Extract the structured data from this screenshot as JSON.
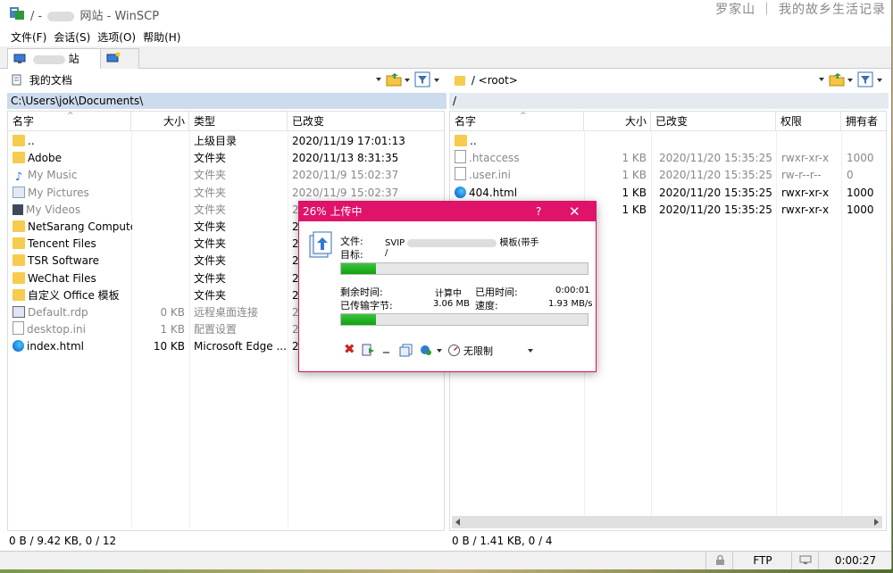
{
  "window": {
    "title_prefix": "/ -",
    "title_mid": "网站 - WinSCP",
    "watermark": "罗家山 ｜ 我的故乡生活记录"
  },
  "menu": [
    "文件(F)",
    "会话(S)",
    "选项(O)",
    "帮助(H)"
  ],
  "tabs": {
    "site_label": "站"
  },
  "left": {
    "path_dropdown": "我的文档",
    "path": "C:\\Users\\jok\\Documents\\",
    "columns": [
      "名字",
      "大小",
      "类型",
      "已改变"
    ],
    "rows": [
      {
        "name": "..",
        "size": "",
        "type": "上级目录",
        "date": "2020/11/19  17:01:13",
        "icon": "up-folder",
        "dim": false
      },
      {
        "name": "Adobe",
        "size": "",
        "type": "文件夹",
        "date": "2020/11/13  8:31:35",
        "icon": "folder",
        "dim": false
      },
      {
        "name": "My Music",
        "size": "",
        "type": "文件夹",
        "date": "2020/11/9  15:02:37",
        "icon": "music",
        "dim": true
      },
      {
        "name": "My Pictures",
        "size": "",
        "type": "文件夹",
        "date": "2020/11/9  15:02:37",
        "icon": "pictures",
        "dim": true
      },
      {
        "name": "My Videos",
        "size": "",
        "type": "文件夹",
        "date": "2",
        "icon": "videos",
        "dim": true
      },
      {
        "name": "NetSarang Computer",
        "size": "",
        "type": "文件夹",
        "date": "2",
        "icon": "folder",
        "dim": false
      },
      {
        "name": "Tencent Files",
        "size": "",
        "type": "文件夹",
        "date": "2",
        "icon": "folder",
        "dim": false
      },
      {
        "name": "TSR Software",
        "size": "",
        "type": "文件夹",
        "date": "2",
        "icon": "folder",
        "dim": false
      },
      {
        "name": "WeChat Files",
        "size": "",
        "type": "文件夹",
        "date": "2",
        "icon": "folder",
        "dim": false
      },
      {
        "name": "自定义 Office 模板",
        "size": "",
        "type": "文件夹",
        "date": "2",
        "icon": "folder",
        "dim": false
      },
      {
        "name": "Default.rdp",
        "size": "0 KB",
        "type": "远程桌面连接",
        "date": "2",
        "icon": "rdp",
        "dim": true
      },
      {
        "name": "desktop.ini",
        "size": "1 KB",
        "type": "配置设置",
        "date": "2",
        "icon": "doc",
        "dim": true
      },
      {
        "name": "index.html",
        "size": "10 KB",
        "type": "Microsoft Edge ...",
        "date": "2",
        "icon": "edge",
        "dim": false
      }
    ],
    "status": "0 B / 9.42 KB,  0 / 12"
  },
  "right": {
    "path_dropdown": "/ <root>",
    "path": "/",
    "columns": [
      "名字",
      "大小",
      "已改变",
      "权限",
      "拥有者"
    ],
    "rows": [
      {
        "name": "..",
        "size": "",
        "date": "",
        "perm": "",
        "owner": "",
        "icon": "up-folder",
        "dim": false
      },
      {
        "name": ".htaccess",
        "size": "1 KB",
        "date": "2020/11/20 15:35:25",
        "perm": "rwxr-xr-x",
        "owner": "1000",
        "icon": "doc",
        "dim": true
      },
      {
        "name": ".user.ini",
        "size": "1 KB",
        "date": "2020/11/20 15:35:25",
        "perm": "rw-r--r--",
        "owner": "0",
        "icon": "doc",
        "dim": true
      },
      {
        "name": "404.html",
        "size": "1 KB",
        "date": "2020/11/20 15:35:25",
        "perm": "rwxr-xr-x",
        "owner": "1000",
        "icon": "edge",
        "dim": false
      },
      {
        "name": "",
        "size": "1 KB",
        "date": "2020/11/20 15:35:25",
        "perm": "rwxr-xr-x",
        "owner": "1000",
        "icon": "",
        "dim": false
      }
    ],
    "status": "0 B / 1.41 KB,  0 / 4"
  },
  "bottom": {
    "protocol": "FTP",
    "elapsed": "0:00:27"
  },
  "dialog": {
    "title": "26% 上传中",
    "help": "?",
    "close": "✕",
    "file_label": "文件:",
    "file_value": "SVIP",
    "file_value_tail": "模板(带手",
    "target_label": "目标:",
    "target_value": "/",
    "file_progress": 0.14,
    "remaining_label": "剩余时间:",
    "remaining_value": "计算中",
    "used_label": "已用时间:",
    "used_value": "0:00:01",
    "transferred_label": "已传输字节:",
    "transferred_value": "3.06 MB",
    "speed_label": "速度:",
    "speed_value": "1.93 MB/s",
    "total_progress": 0.14,
    "speed_limit": "无限制"
  }
}
